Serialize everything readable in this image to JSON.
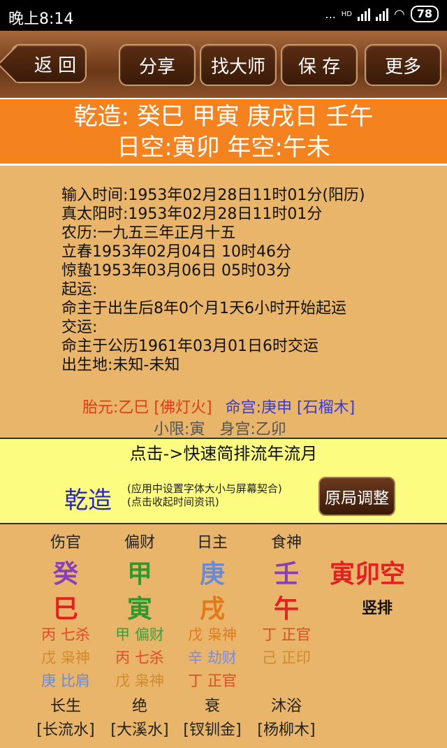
{
  "status": {
    "time": "晚上8:14",
    "battery": "78",
    "dots": "...",
    "network": "HD"
  },
  "toolbar": {
    "back": "返 回",
    "share": "分享",
    "master": "找大师",
    "save": "保 存",
    "more": "更多"
  },
  "header": {
    "line1": "乾造: 癸巳 甲寅 庚戌日 壬午",
    "line2": "日空:寅卯 年空:午未"
  },
  "info": [
    "输入时间:1953年02月28日11时01分(阳历)",
    "真太阳时:1953年02月28日11时01分",
    "农历:一九五三年正月十五",
    "立春1953年02月04日 10时46分",
    "惊蛰1953年03月06日 05时03分",
    "起运:",
    "命主于出生后8年0个月1天6小时开始起运",
    "交运:",
    "命主于公历1961年03月01日6时交运",
    "出生地:未知-未知"
  ],
  "taiyuan": "胎元:乙巳 [佛灯火]",
  "minggong": "命宫:庚申 [石榴木]",
  "xiaoxian": "小限:寅   身宫:乙卯",
  "quick_link": "点击->快速简排流年流月",
  "panel": {
    "label": "乾造",
    "hint1": "(应用中设置字体大小与屏幕契合)",
    "hint2": "(点击收起时间资讯)",
    "adjust": "原局调整"
  },
  "pillars": [
    {
      "god": "伤官",
      "stem": "癸",
      "stem_color": "#8a3fb8",
      "branch": "巳",
      "branch_color": "#e52020",
      "hidden": [
        {
          "t": "丙 七杀",
          "c": "#e04a2a"
        },
        {
          "t": "戊 枭神",
          "c": "#d08a2a"
        },
        {
          "t": "庚 比肩",
          "c": "#6a8ad8"
        }
      ],
      "stage": "长生",
      "nayin": "[长流水]"
    },
    {
      "god": "偏财",
      "stem": "甲",
      "stem_color": "#2e9a2e",
      "branch": "寅",
      "branch_color": "#2e9a2e",
      "hidden": [
        {
          "t": "甲 偏财",
          "c": "#3aa03a"
        },
        {
          "t": "丙 七杀",
          "c": "#e04a2a"
        },
        {
          "t": "戊 枭神",
          "c": "#d08a2a"
        }
      ],
      "stage": "绝",
      "nayin": "[大溪水]"
    },
    {
      "god": "日主",
      "stem": "庚",
      "stem_color": "#6a8ad8",
      "branch": "戌",
      "branch_color": "#e07a1a",
      "hidden": [
        {
          "t": "戊 枭神",
          "c": "#e07a1a"
        },
        {
          "t": "辛 劫财",
          "c": "#7a8ae0"
        },
        {
          "t": "丁 正官",
          "c": "#e04a2a"
        }
      ],
      "stage": "衰",
      "nayin": "[钗钏金]"
    },
    {
      "god": "食神",
      "stem": "壬",
      "stem_color": "#8a3fb8",
      "branch": "午",
      "branch_color": "#e52020",
      "hidden": [
        {
          "t": "丁 正官",
          "c": "#e04a2a"
        },
        {
          "t": "己 正印",
          "c": "#d08a2a"
        }
      ],
      "stage": "沐浴",
      "nayin": "[杨柳木]"
    }
  ],
  "kong": "寅卯空",
  "shupai": "竖排"
}
